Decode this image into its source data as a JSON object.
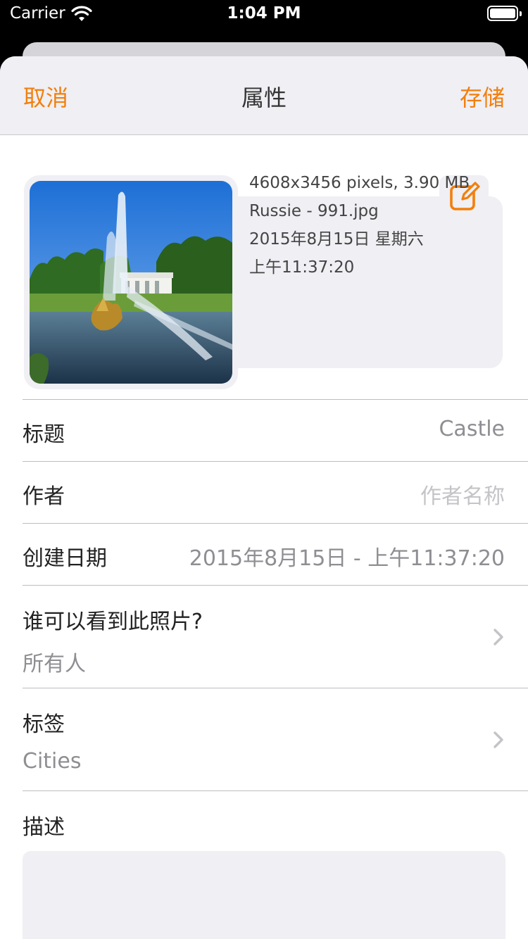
{
  "status_bar": {
    "carrier": "Carrier",
    "time": "1:04 PM"
  },
  "nav": {
    "cancel_label": "取消",
    "title": "属性",
    "save_label": "存储"
  },
  "photo_info": {
    "dimensions_size": "4608x3456 pixels, 3.90 MB",
    "filename": "Russie - 991.jpg",
    "date_line": "2015年8月15日 星期六",
    "time_line": "上午11:37:20"
  },
  "fields": {
    "title": {
      "label": "标题",
      "value": "Castle"
    },
    "author": {
      "label": "作者",
      "placeholder": "作者名称"
    },
    "created": {
      "label": "创建日期",
      "value": "2015年8月15日 - 上午11:37:20"
    },
    "visibility": {
      "label": "谁可以看到此照片?",
      "value": "所有人"
    },
    "tags": {
      "label": "标签",
      "value": "Cities"
    },
    "description": {
      "label": "描述"
    }
  },
  "colors": {
    "accent": "#f27f0c",
    "card_bg": "#efeff4",
    "secondary_text": "#8e8e93"
  }
}
